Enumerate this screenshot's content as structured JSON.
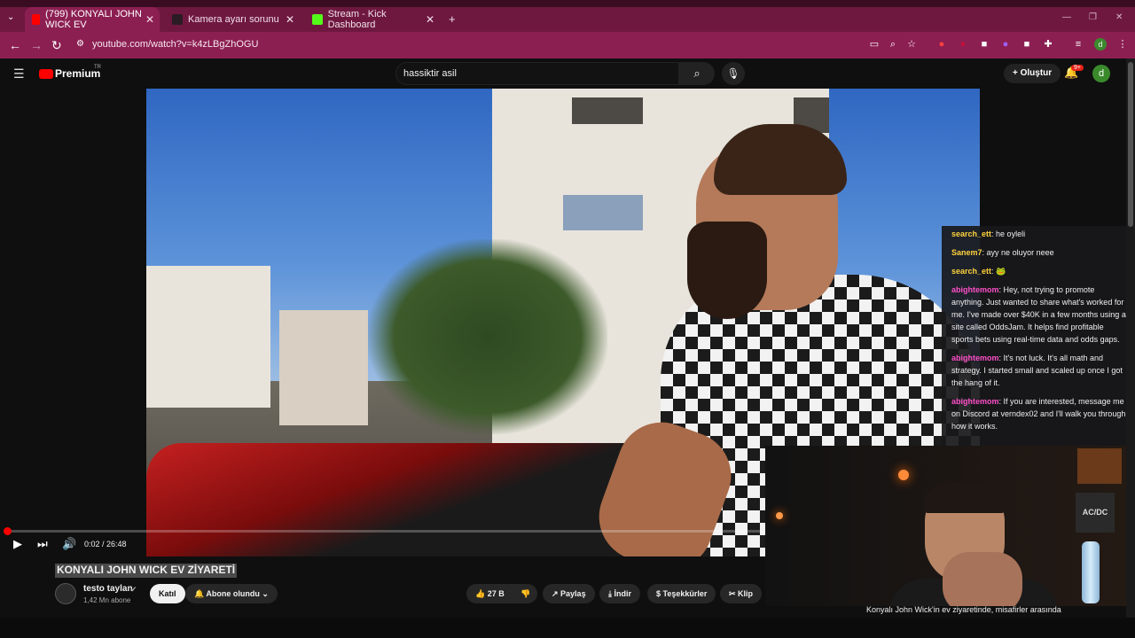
{
  "browser": {
    "tabs": [
      {
        "label": "(799) KONYALI JOHN WICK EV",
        "active": true,
        "favicon": "youtube-favicon"
      },
      {
        "label": "Kamera ayarı sorunu",
        "active": false,
        "favicon": "generic-favicon"
      },
      {
        "label": "Stream - Kick Dashboard",
        "active": false,
        "favicon": "kick-favicon"
      }
    ],
    "new_tab": "+",
    "url": "youtube.com/watch?v=k4zLBgZhOGU"
  },
  "youtube": {
    "logo_text": "Premium",
    "logo_suffix": "TR",
    "search": {
      "value": "hassiktir asil"
    },
    "create_label": "Oluştur",
    "notification_count": "9+",
    "avatar_letter": "d"
  },
  "player": {
    "time": "0:02 / 26:48",
    "progress": 0.0012
  },
  "video": {
    "title": "KONYALI JOHN WICK EV ZİYARETİ",
    "channel": "testo taylan",
    "subscribers": "1,42 Mn abone",
    "join_label": "Katıl",
    "subscribed_label": "Abone olundu",
    "likes": "27 B",
    "share_label": "Paylaş",
    "download_label": "İndir",
    "thanks_label": "Teşekkürler",
    "clip_label": "Klip",
    "description_start": "Konyalı John Wick'in ev ziyaretinde, misafirler arasında"
  },
  "chat": {
    "messages": [
      {
        "user": "search_ett",
        "color": "#ffd33d",
        "text": "he oyleli"
      },
      {
        "user": "Sanem7",
        "color": "#ffd33d",
        "text": "ayy ne oluyor neee"
      },
      {
        "user": "search_ett",
        "color": "#ffd33d",
        "text": "🐸"
      },
      {
        "user": "abightemom",
        "color": "#ff4fc8",
        "text": "Hey, not trying to promote anything. Just wanted to share what's worked for me. I've made over $40K in a few months using a site called OddsJam. It helps find profitable sports bets using real-time data and odds gaps."
      },
      {
        "user": "abightemom",
        "color": "#ff4fc8",
        "text": "It's not luck. It's all math and strategy. I started small and scaled up once I got the hang of it."
      },
      {
        "user": "abightemom",
        "color": "#ff4fc8",
        "text": "If you are interested, message me on Discord at verndex02 and I'll walk you through how it works."
      }
    ]
  },
  "webcam": {
    "poster_text": "AC/DC"
  },
  "colors": {
    "tab_bar": "#6e1840",
    "address_bar": "#8c1f52",
    "youtube_red": "#ff0000"
  }
}
